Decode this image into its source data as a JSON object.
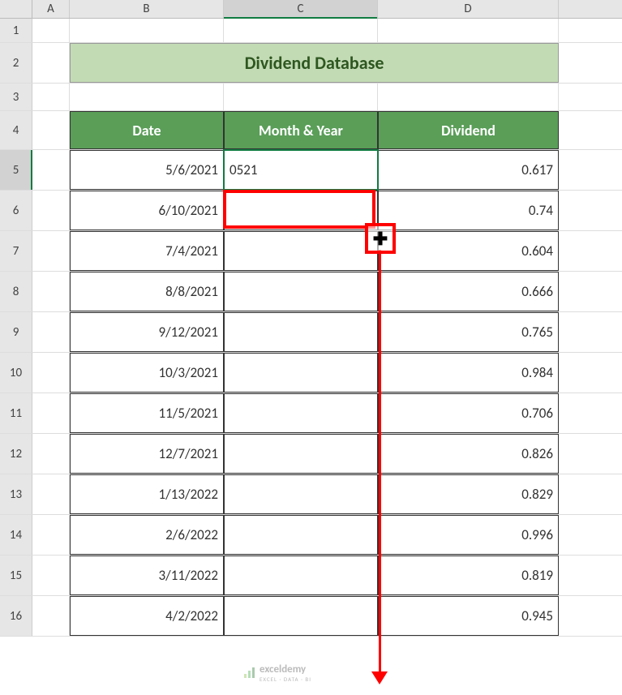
{
  "col_headers": {
    "a": "A",
    "b": "B",
    "c": "C",
    "d": "D"
  },
  "row_headers": [
    "1",
    "2",
    "3",
    "4",
    "5",
    "6",
    "7",
    "8",
    "9",
    "10",
    "11",
    "12",
    "13",
    "14",
    "15",
    "16"
  ],
  "title": "Dividend Database",
  "table_headers": {
    "date": "Date",
    "monthyear": "Month & Year",
    "dividend": "Dividend"
  },
  "rows": [
    {
      "date": "5/6/2021",
      "monthyear": "0521",
      "dividend": "0.617"
    },
    {
      "date": "6/10/2021",
      "monthyear": "",
      "dividend": "0.74"
    },
    {
      "date": "7/4/2021",
      "monthyear": "",
      "dividend": "0.604"
    },
    {
      "date": "8/8/2021",
      "monthyear": "",
      "dividend": "0.666"
    },
    {
      "date": "9/12/2021",
      "monthyear": "",
      "dividend": "0.765"
    },
    {
      "date": "10/3/2021",
      "monthyear": "",
      "dividend": "0.984"
    },
    {
      "date": "11/5/2021",
      "monthyear": "",
      "dividend": "0.706"
    },
    {
      "date": "12/7/2021",
      "monthyear": "",
      "dividend": "0.826"
    },
    {
      "date": "1/13/2022",
      "monthyear": "",
      "dividend": "0.829"
    },
    {
      "date": "2/6/2022",
      "monthyear": "",
      "dividend": "0.996"
    },
    {
      "date": "3/11/2022",
      "monthyear": "",
      "dividend": "0.819"
    },
    {
      "date": "4/2/2022",
      "monthyear": "",
      "dividend": "0.945"
    }
  ],
  "watermark": "exceldemy",
  "watermark_sub": "EXCEL · DATA · BI",
  "fill_handle": "✚"
}
